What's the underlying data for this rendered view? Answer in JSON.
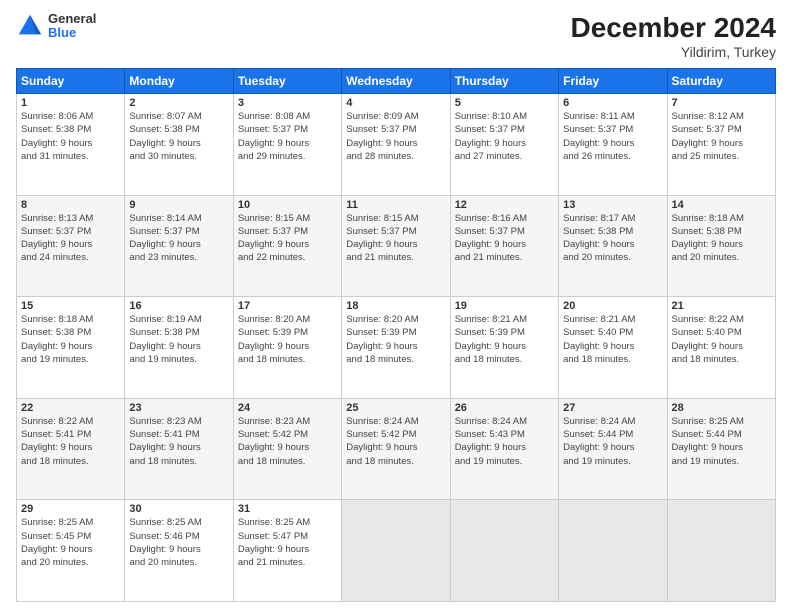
{
  "header": {
    "logo_general": "General",
    "logo_blue": "Blue",
    "title": "December 2024",
    "subtitle": "Yildirim, Turkey"
  },
  "days_of_week": [
    "Sunday",
    "Monday",
    "Tuesday",
    "Wednesday",
    "Thursday",
    "Friday",
    "Saturday"
  ],
  "weeks": [
    [
      {
        "day": "1",
        "info": "Sunrise: 8:06 AM\nSunset: 5:38 PM\nDaylight: 9 hours\nand 31 minutes."
      },
      {
        "day": "2",
        "info": "Sunrise: 8:07 AM\nSunset: 5:38 PM\nDaylight: 9 hours\nand 30 minutes."
      },
      {
        "day": "3",
        "info": "Sunrise: 8:08 AM\nSunset: 5:37 PM\nDaylight: 9 hours\nand 29 minutes."
      },
      {
        "day": "4",
        "info": "Sunrise: 8:09 AM\nSunset: 5:37 PM\nDaylight: 9 hours\nand 28 minutes."
      },
      {
        "day": "5",
        "info": "Sunrise: 8:10 AM\nSunset: 5:37 PM\nDaylight: 9 hours\nand 27 minutes."
      },
      {
        "day": "6",
        "info": "Sunrise: 8:11 AM\nSunset: 5:37 PM\nDaylight: 9 hours\nand 26 minutes."
      },
      {
        "day": "7",
        "info": "Sunrise: 8:12 AM\nSunset: 5:37 PM\nDaylight: 9 hours\nand 25 minutes."
      }
    ],
    [
      {
        "day": "8",
        "info": "Sunrise: 8:13 AM\nSunset: 5:37 PM\nDaylight: 9 hours\nand 24 minutes."
      },
      {
        "day": "9",
        "info": "Sunrise: 8:14 AM\nSunset: 5:37 PM\nDaylight: 9 hours\nand 23 minutes."
      },
      {
        "day": "10",
        "info": "Sunrise: 8:15 AM\nSunset: 5:37 PM\nDaylight: 9 hours\nand 22 minutes."
      },
      {
        "day": "11",
        "info": "Sunrise: 8:15 AM\nSunset: 5:37 PM\nDaylight: 9 hours\nand 21 minutes."
      },
      {
        "day": "12",
        "info": "Sunrise: 8:16 AM\nSunset: 5:37 PM\nDaylight: 9 hours\nand 21 minutes."
      },
      {
        "day": "13",
        "info": "Sunrise: 8:17 AM\nSunset: 5:38 PM\nDaylight: 9 hours\nand 20 minutes."
      },
      {
        "day": "14",
        "info": "Sunrise: 8:18 AM\nSunset: 5:38 PM\nDaylight: 9 hours\nand 20 minutes."
      }
    ],
    [
      {
        "day": "15",
        "info": "Sunrise: 8:18 AM\nSunset: 5:38 PM\nDaylight: 9 hours\nand 19 minutes."
      },
      {
        "day": "16",
        "info": "Sunrise: 8:19 AM\nSunset: 5:38 PM\nDaylight: 9 hours\nand 19 minutes."
      },
      {
        "day": "17",
        "info": "Sunrise: 8:20 AM\nSunset: 5:39 PM\nDaylight: 9 hours\nand 18 minutes."
      },
      {
        "day": "18",
        "info": "Sunrise: 8:20 AM\nSunset: 5:39 PM\nDaylight: 9 hours\nand 18 minutes."
      },
      {
        "day": "19",
        "info": "Sunrise: 8:21 AM\nSunset: 5:39 PM\nDaylight: 9 hours\nand 18 minutes."
      },
      {
        "day": "20",
        "info": "Sunrise: 8:21 AM\nSunset: 5:40 PM\nDaylight: 9 hours\nand 18 minutes."
      },
      {
        "day": "21",
        "info": "Sunrise: 8:22 AM\nSunset: 5:40 PM\nDaylight: 9 hours\nand 18 minutes."
      }
    ],
    [
      {
        "day": "22",
        "info": "Sunrise: 8:22 AM\nSunset: 5:41 PM\nDaylight: 9 hours\nand 18 minutes."
      },
      {
        "day": "23",
        "info": "Sunrise: 8:23 AM\nSunset: 5:41 PM\nDaylight: 9 hours\nand 18 minutes."
      },
      {
        "day": "24",
        "info": "Sunrise: 8:23 AM\nSunset: 5:42 PM\nDaylight: 9 hours\nand 18 minutes."
      },
      {
        "day": "25",
        "info": "Sunrise: 8:24 AM\nSunset: 5:42 PM\nDaylight: 9 hours\nand 18 minutes."
      },
      {
        "day": "26",
        "info": "Sunrise: 8:24 AM\nSunset: 5:43 PM\nDaylight: 9 hours\nand 19 minutes."
      },
      {
        "day": "27",
        "info": "Sunrise: 8:24 AM\nSunset: 5:44 PM\nDaylight: 9 hours\nand 19 minutes."
      },
      {
        "day": "28",
        "info": "Sunrise: 8:25 AM\nSunset: 5:44 PM\nDaylight: 9 hours\nand 19 minutes."
      }
    ],
    [
      {
        "day": "29",
        "info": "Sunrise: 8:25 AM\nSunset: 5:45 PM\nDaylight: 9 hours\nand 20 minutes."
      },
      {
        "day": "30",
        "info": "Sunrise: 8:25 AM\nSunset: 5:46 PM\nDaylight: 9 hours\nand 20 minutes."
      },
      {
        "day": "31",
        "info": "Sunrise: 8:25 AM\nSunset: 5:47 PM\nDaylight: 9 hours\nand 21 minutes."
      },
      {
        "day": "",
        "info": ""
      },
      {
        "day": "",
        "info": ""
      },
      {
        "day": "",
        "info": ""
      },
      {
        "day": "",
        "info": ""
      }
    ]
  ]
}
